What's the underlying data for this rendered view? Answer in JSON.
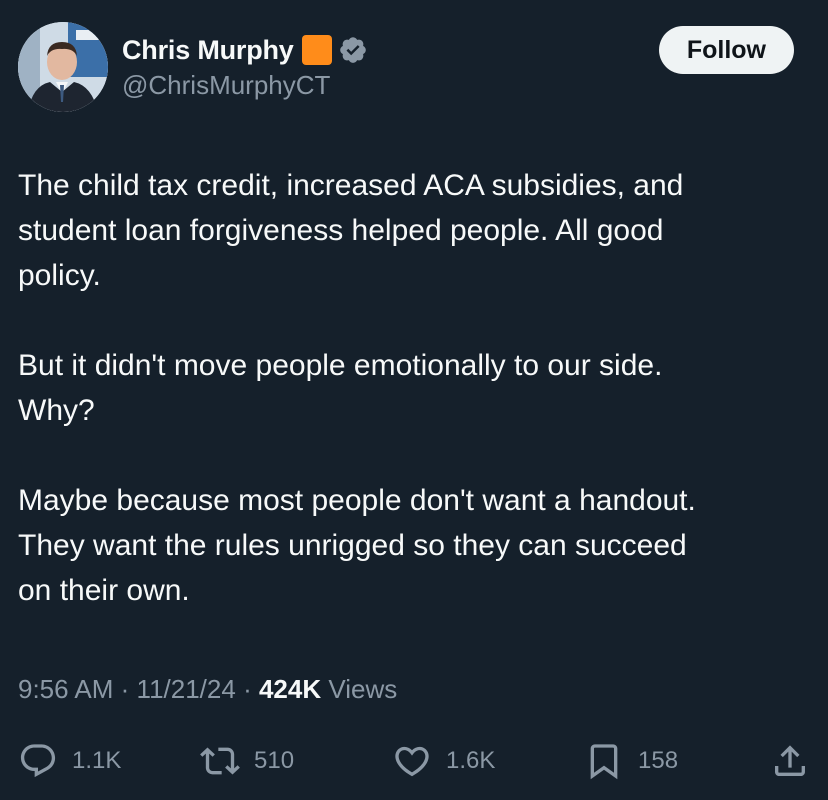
{
  "author": {
    "display_name": "Chris Murphy",
    "handle": "@ChrisMurphyCT",
    "flag_emoji_icon": "orange-square-icon",
    "verified_icon": "verified-badge-icon",
    "verified_color": "#8b98a5",
    "flag_color": "#ff8c1a"
  },
  "follow_button": {
    "label": "Follow"
  },
  "tweet": {
    "paragraphs": [
      "The child tax credit, increased ACA subsidies, and\nstudent loan forgiveness helped people. All good\npolicy.",
      "But it didn't move people emotionally to our side.\nWhy?",
      "Maybe because most people don't want a handout.\nThey want the rules unrigged so they can succeed\non their own."
    ]
  },
  "meta": {
    "time": "9:56 AM",
    "separator": "·",
    "date": "11/21/24",
    "views_count": "424K",
    "views_label": "Views"
  },
  "actions": {
    "replies": "1.1K",
    "reposts": "510",
    "likes": "1.6K",
    "bookmarks": "158"
  },
  "colors": {
    "background": "#15202b",
    "text": "#f7f9f9",
    "secondary_text": "#8b98a5"
  }
}
